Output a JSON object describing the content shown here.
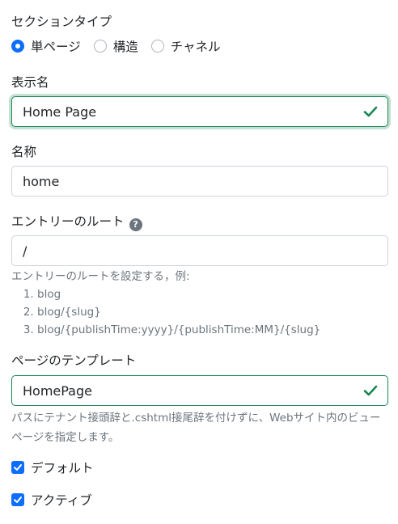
{
  "section_type": {
    "label": "セクションタイプ",
    "options": [
      {
        "label": "単ページ",
        "checked": true
      },
      {
        "label": "構造",
        "checked": false
      },
      {
        "label": "チャネル",
        "checked": false
      }
    ]
  },
  "display_name": {
    "label": "表示名",
    "value": "Home Page",
    "status_icon": "check-icon"
  },
  "name": {
    "label": "名称",
    "value": "home"
  },
  "entry_route": {
    "label": "エントリーのルート",
    "help_icon": "question-circle-icon",
    "value": "/",
    "help_text": "エントリーのルートを設定する，例:",
    "examples": [
      "blog",
      "blog/{slug}",
      "blog/{publishTime:yyyy}/{publishTime:MM}/{slug}"
    ]
  },
  "page_template": {
    "label": "ページのテンプレート",
    "value": "HomePage",
    "status_icon": "check-icon",
    "help_text": "パスにテナント接頭辞と.cshtml接尾辞を付けずに、Webサイト内のビューページを指定します。"
  },
  "checkboxes": [
    {
      "label": "デフォルト",
      "checked": true
    },
    {
      "label": "アクティブ",
      "checked": true
    }
  ],
  "colors": {
    "primary": "#0d6efd",
    "valid": "#198754",
    "muted": "#6c757d"
  }
}
